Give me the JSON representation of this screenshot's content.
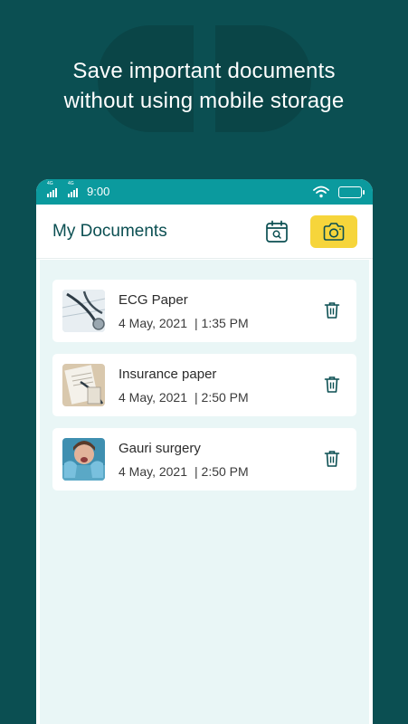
{
  "headline": {
    "line1": "Save important  documents",
    "line2": "without using mobile storage"
  },
  "statusbar": {
    "time": "9:00",
    "network1": "4G",
    "network2": "4G"
  },
  "appbar": {
    "title": "My Documents"
  },
  "documents": [
    {
      "name": "ECG Paper",
      "date": "4 May, 2021",
      "time": "| 1:35 PM"
    },
    {
      "name": "Insurance paper",
      "date": "4 May, 2021",
      "time": "| 2:50 PM"
    },
    {
      "name": "Gauri surgery",
      "date": "4 May, 2021",
      "time": "| 2:50 PM"
    }
  ],
  "colors": {
    "background": "#0b4f52",
    "statusbar": "#0b9a9e",
    "camera_button": "#f6d53b",
    "list_background": "#e9f6f6",
    "icon": "#0b4f52"
  },
  "icons": [
    "signal-icon",
    "wifi-icon",
    "battery-icon",
    "calendar-search-icon",
    "camera-icon",
    "trash-icon"
  ]
}
